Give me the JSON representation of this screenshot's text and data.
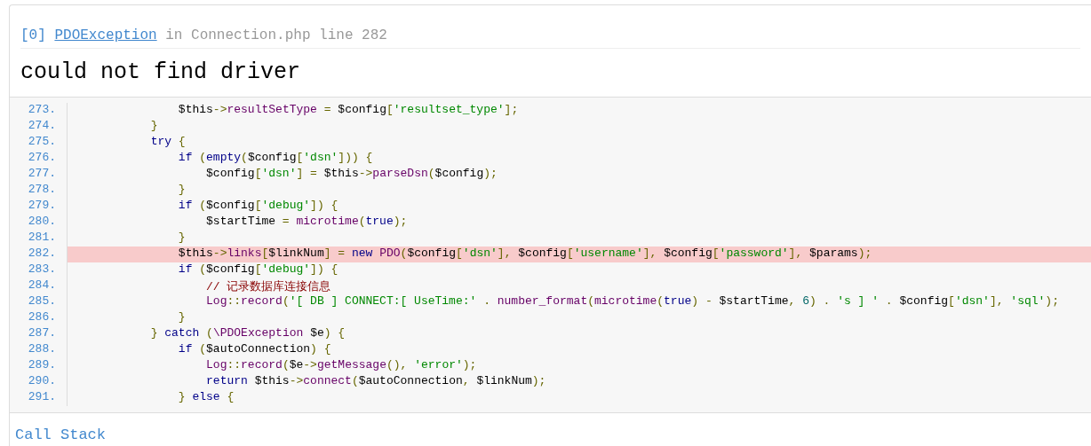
{
  "exception": {
    "index": "[0]",
    "class": "PDOException",
    "location": "in Connection.php line 282"
  },
  "message": "could not find driver",
  "source": {
    "lines": [
      {
        "number": "273.",
        "code": "                $this->resultSetType = $config['resultset_type'];",
        "highlighted": false
      },
      {
        "number": "274.",
        "code": "            }",
        "highlighted": false
      },
      {
        "number": "275.",
        "code": "            try {",
        "highlighted": false
      },
      {
        "number": "276.",
        "code": "                if (empty($config['dsn'])) {",
        "highlighted": false
      },
      {
        "number": "277.",
        "code": "                    $config['dsn'] = $this->parseDsn($config);",
        "highlighted": false
      },
      {
        "number": "278.",
        "code": "                }",
        "highlighted": false
      },
      {
        "number": "279.",
        "code": "                if ($config['debug']) {",
        "highlighted": false
      },
      {
        "number": "280.",
        "code": "                    $startTime = microtime(true);",
        "highlighted": false
      },
      {
        "number": "281.",
        "code": "                }",
        "highlighted": false
      },
      {
        "number": "282.",
        "code": "                $this->links[$linkNum] = new PDO($config['dsn'], $config['username'], $config['password'], $params);",
        "highlighted": true
      },
      {
        "number": "283.",
        "code": "                if ($config['debug']) {",
        "highlighted": false
      },
      {
        "number": "284.",
        "code": "                    // 记录数据库连接信息",
        "highlighted": false
      },
      {
        "number": "285.",
        "code": "                    Log::record('[ DB ] CONNECT:[ UseTime:' . number_format(microtime(true) - $startTime, 6) . 's ] ' . $config['dsn'], 'sql');",
        "highlighted": false
      },
      {
        "number": "286.",
        "code": "                }",
        "highlighted": false
      },
      {
        "number": "287.",
        "code": "            } catch (\\PDOException $e) {",
        "highlighted": false
      },
      {
        "number": "288.",
        "code": "                if ($autoConnection) {",
        "highlighted": false
      },
      {
        "number": "289.",
        "code": "                    Log::record($e->getMessage(), 'error');",
        "highlighted": false
      },
      {
        "number": "290.",
        "code": "                    return $this->connect($autoConnection, $linkNum);",
        "highlighted": false
      },
      {
        "number": "291.",
        "code": "                } else {",
        "highlighted": false
      }
    ]
  },
  "call_stack": {
    "title": "Call Stack"
  }
}
